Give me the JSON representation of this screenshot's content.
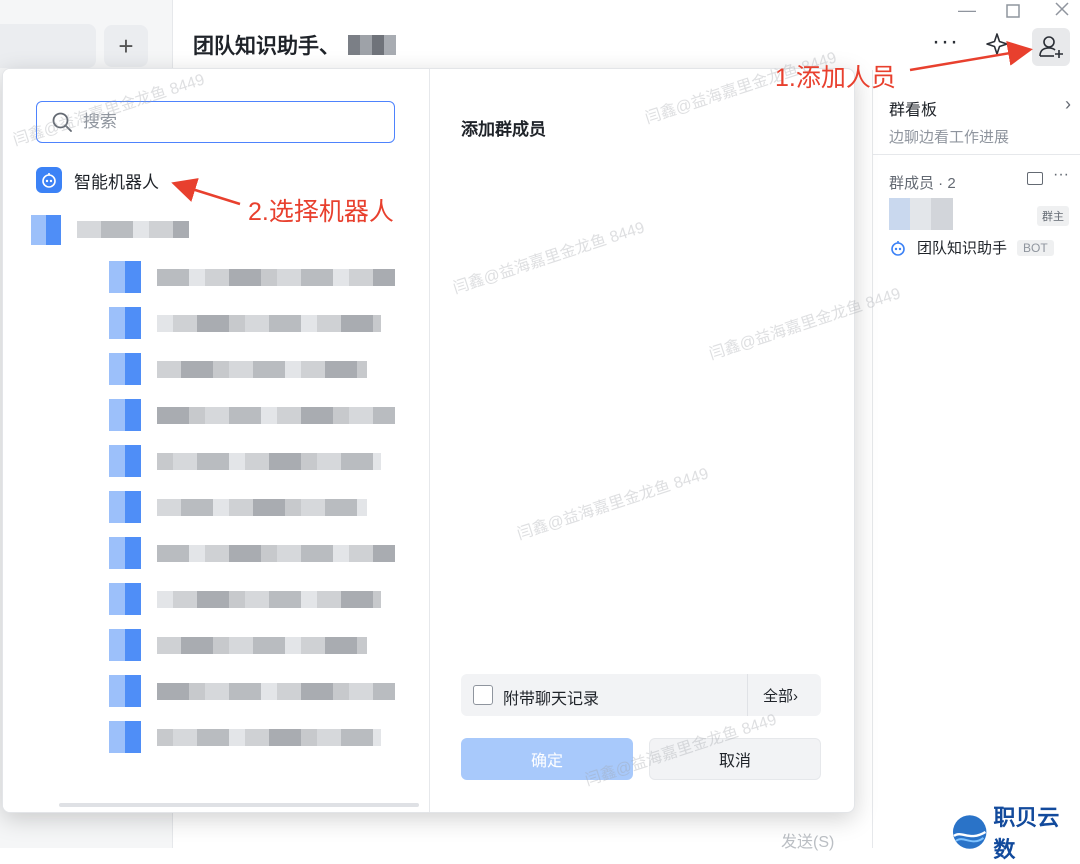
{
  "app": {
    "chat_title": "团队知识助手、",
    "send_label": "发送(S)"
  },
  "right_panel": {
    "board_title": "群看板",
    "board_subtitle": "边聊边看工作进展",
    "members_label": "群成员 · 2",
    "owner_badge": "群主",
    "bot_name": "团队知识助手",
    "bot_badge": "BOT"
  },
  "dialog": {
    "search_placeholder": "搜索",
    "bot_item_label": "智能机器人",
    "title": "添加群成员",
    "attach_history_label": "附带聊天记录",
    "all_label": "全部",
    "confirm_label": "确定",
    "cancel_label": "取消"
  },
  "annotations": {
    "step1": "1.添加人员",
    "step2": "2.选择机器人",
    "color": "#e8402e"
  },
  "watermarks": [
    "闫鑫@益海嘉里金龙鱼 8449",
    "闫鑫@益海嘉里金龙鱼 8449",
    "闫鑫@益海嘉里金龙鱼 8449",
    "闫鑫@益海嘉里金龙鱼 8449",
    "闫鑫@益海嘉里金龙鱼 8449",
    "闫鑫@益海嘉里金龙鱼 8449"
  ],
  "brand": {
    "name": "职贝云数"
  },
  "colors": {
    "accent": "#4e83fd",
    "confirm_disabled": "#a8c9fb",
    "annotation_red": "#e8402e"
  }
}
